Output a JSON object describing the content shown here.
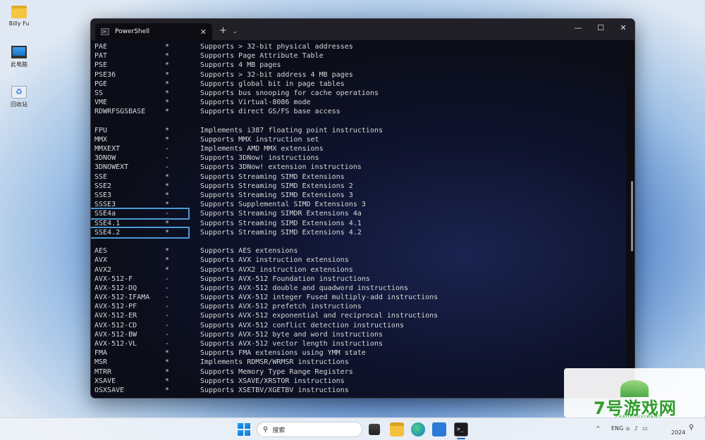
{
  "desktop": {
    "icons": [
      {
        "label": "Billy Fu",
        "icon": "folder-icon"
      },
      {
        "label": "此电脑",
        "icon": "computer-icon"
      },
      {
        "label": "回收站",
        "icon": "recycle-bin-icon"
      }
    ]
  },
  "window": {
    "tab_title": "PowerShell",
    "tab_icon": "powershell-icon",
    "new_tab": "+",
    "dropdown": "⌄",
    "minimize": "—",
    "maximize": "☐",
    "close": "✕"
  },
  "features": {
    "group1": [
      {
        "name": "PAE",
        "flag": "*",
        "desc": "Supports > 32-bit physical addresses"
      },
      {
        "name": "PAT",
        "flag": "*",
        "desc": "Supports Page Attribute Table"
      },
      {
        "name": "PSE",
        "flag": "*",
        "desc": "Supports 4 MB pages"
      },
      {
        "name": "PSE36",
        "flag": "*",
        "desc": "Supports > 32-bit address 4 MB pages"
      },
      {
        "name": "PGE",
        "flag": "*",
        "desc": "Supports global bit in page tables"
      },
      {
        "name": "SS",
        "flag": "*",
        "desc": "Supports bus snooping for cache operations"
      },
      {
        "name": "VME",
        "flag": "*",
        "desc": "Supports Virtual-8086 mode"
      },
      {
        "name": "RDWRFSGSBASE",
        "flag": "*",
        "desc": "Supports direct GS/FS base access"
      }
    ],
    "group2": [
      {
        "name": "FPU",
        "flag": "*",
        "desc": "Implements i387 floating point instructions"
      },
      {
        "name": "MMX",
        "flag": "*",
        "desc": "Supports MMX instruction set"
      },
      {
        "name": "MMXEXT",
        "flag": "-",
        "desc": "Implements AMD MMX extensions"
      },
      {
        "name": "3DNOW",
        "flag": "-",
        "desc": "Supports 3DNow! instructions"
      },
      {
        "name": "3DNOWEXT",
        "flag": "-",
        "desc": "Supports 3DNow! extension instructions"
      },
      {
        "name": "SSE",
        "flag": "*",
        "desc": "Supports Streaming SIMD Extensions"
      },
      {
        "name": "SSE2",
        "flag": "*",
        "desc": "Supports Streaming SIMD Extensions 2"
      },
      {
        "name": "SSE3",
        "flag": "*",
        "desc": "Supports Streaming SIMD Extensions 3"
      },
      {
        "name": "SSSE3",
        "flag": "*",
        "desc": "Supports Supplemental SIMD Extensions 3"
      },
      {
        "name": "SSE4a",
        "flag": "-",
        "desc": "Supports Streaming SIMDR Extensions 4a"
      },
      {
        "name": "SSE4.1",
        "flag": "*",
        "desc": "Supports Streaming SIMD Extensions 4.1"
      },
      {
        "name": "SSE4.2",
        "flag": "*",
        "desc": "Supports Streaming SIMD Extensions 4.2"
      }
    ],
    "group3": [
      {
        "name": "AES",
        "flag": "*",
        "desc": "Supports AES extensions"
      },
      {
        "name": "AVX",
        "flag": "*",
        "desc": "Supports AVX instruction extensions"
      },
      {
        "name": "AVX2",
        "flag": "*",
        "desc": "Supports AVX2 instruction extensions"
      },
      {
        "name": "AVX-512-F",
        "flag": "-",
        "desc": "Supports AVX-512 Foundation instructions"
      },
      {
        "name": "AVX-512-DQ",
        "flag": "-",
        "desc": "Supports AVX-512 double and quadword instructions"
      },
      {
        "name": "AVX-512-IFAMA",
        "flag": "-",
        "desc": "Supports AVX-512 integer Fused multiply-add instructions"
      },
      {
        "name": "AVX-512-PF",
        "flag": "-",
        "desc": "Supports AVX-512 prefetch instructions"
      },
      {
        "name": "AVX-512-ER",
        "flag": "-",
        "desc": "Supports AVX-512 exponential and reciprocal instructions"
      },
      {
        "name": "AVX-512-CD",
        "flag": "-",
        "desc": "Supports AVX-512 conflict detection instructions"
      },
      {
        "name": "AVX-512-BW",
        "flag": "-",
        "desc": "Supports AVX-512 byte and word instructions"
      },
      {
        "name": "AVX-512-VL",
        "flag": "-",
        "desc": "Supports AVX-512 vector length instructions"
      },
      {
        "name": "FMA",
        "flag": "*",
        "desc": "Supports FMA extensions using YMM state"
      },
      {
        "name": "MSR",
        "flag": "*",
        "desc": "Implements RDMSR/WRMSR instructions"
      },
      {
        "name": "MTRR",
        "flag": "*",
        "desc": "Supports Memory Type Range Registers"
      },
      {
        "name": "XSAVE",
        "flag": "*",
        "desc": "Supports XSAVE/XRSTOR instructions"
      },
      {
        "name": "OSXSAVE",
        "flag": "*",
        "desc": "Supports XSETBV/XGETBV instructions"
      }
    ]
  },
  "highlighted": [
    "SSE4a",
    "SSE4.2"
  ],
  "taskbar": {
    "search_placeholder": "搜索",
    "apps": [
      "task-view-icon",
      "file-explorer-icon",
      "edge-icon",
      "store-icon",
      "terminal-icon"
    ],
    "tray_chevron": "^",
    "language": "ENG",
    "tray_icons": "⌂ ♪ ▭",
    "year": "2024",
    "notification": "⚲"
  },
  "watermark": {
    "logo": "7号游戏网",
    "sub": "ZHAOYOUXIWANG"
  },
  "colors": {
    "highlight": "#4a9ad6",
    "terminal_bg": "#0c0c12",
    "text": "#d8d8d8"
  }
}
